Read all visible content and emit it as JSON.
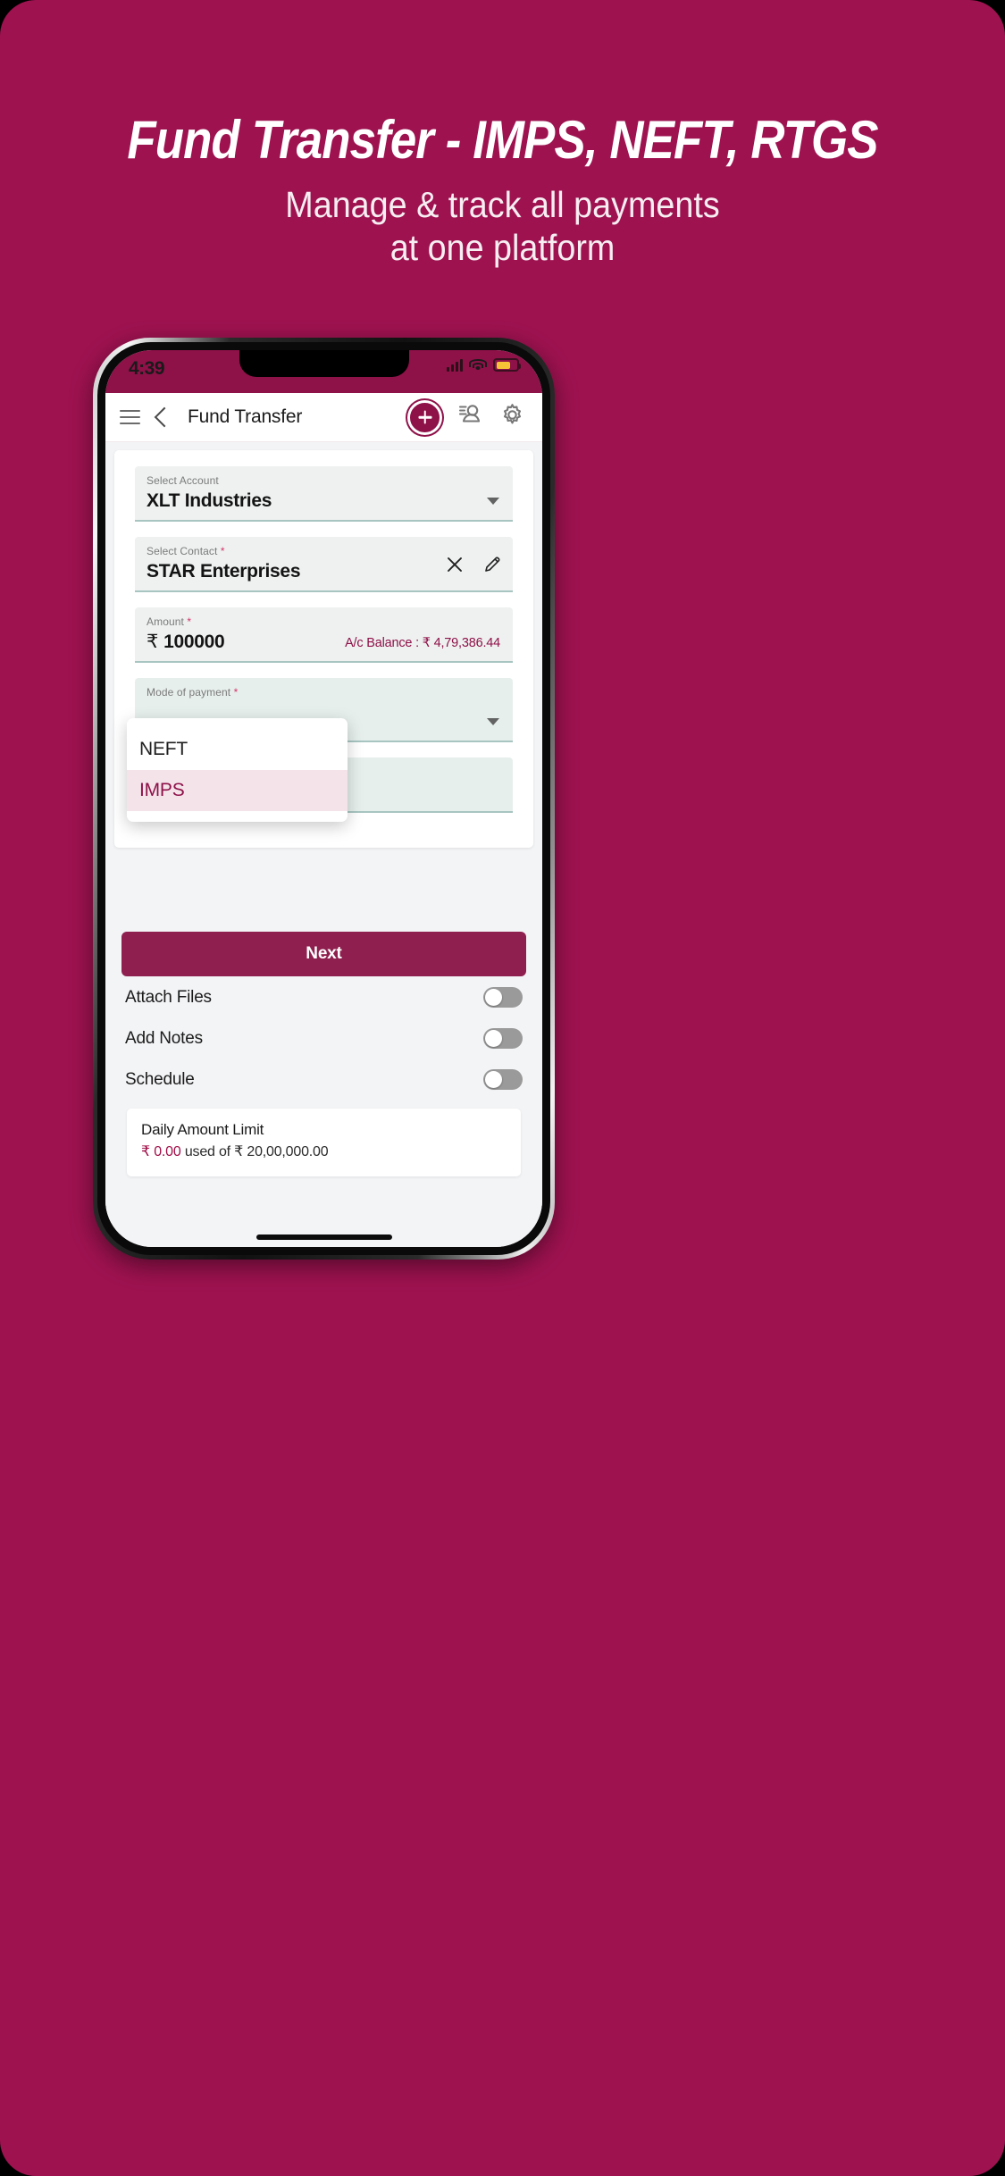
{
  "poster": {
    "background_color": "#9e1250",
    "headline": "Fund Transfer - IMPS, NEFT, RTGS",
    "subtitle_line1": "Manage & track all payments",
    "subtitle_line2": "at one platform"
  },
  "status_bar": {
    "time": "4:39",
    "icons": [
      "signal-bars-icon",
      "wifi-icon",
      "battery-icon"
    ],
    "battery_color": "#f6c337"
  },
  "app_bar": {
    "menu_icon": "hamburger-menu-icon",
    "back_icon": "back-chevron-icon",
    "title": "Fund Transfer",
    "actions": [
      {
        "name": "add-button",
        "icon": "plus-icon"
      },
      {
        "name": "contacts-button",
        "icon": "person-contact-icon"
      },
      {
        "name": "settings-button",
        "icon": "gear-icon"
      }
    ]
  },
  "form": {
    "account": {
      "label": "Select Account",
      "value": "XLT Industries",
      "dropdown_icon": "chevron-down-icon"
    },
    "contact": {
      "label": "Select Contact",
      "required_mark": "*",
      "value": "STAR Enterprises",
      "clear_icon": "close-x-icon",
      "edit_icon": "pencil-edit-icon"
    },
    "amount": {
      "label": "Amount",
      "required_mark": "*",
      "currency": "₹",
      "value": "100000",
      "balance_text": "A/c Balance : ₹ 4,79,386.44",
      "balance_color": "#8e1148"
    },
    "mode_of_payment": {
      "label": "Mode of payment",
      "required_mark": "*",
      "options": [
        {
          "label": "NEFT",
          "selected": false
        },
        {
          "label": "IMPS",
          "selected": true
        }
      ],
      "selected_bg": "#f4e4ea",
      "selected_color": "#8e1148"
    }
  },
  "actions": {
    "next_label": "Next",
    "next_color": "#8e1f4e",
    "toggles": [
      {
        "label": "Attach Files",
        "on": false
      },
      {
        "label": "Add Notes",
        "on": false
      },
      {
        "label": "Schedule",
        "on": false
      }
    ]
  },
  "limit": {
    "title": "Daily Amount Limit",
    "used": "₹ 0.00",
    "middle": " used of ",
    "total": "₹ 20,00,000.00",
    "used_color": "#a01048"
  }
}
